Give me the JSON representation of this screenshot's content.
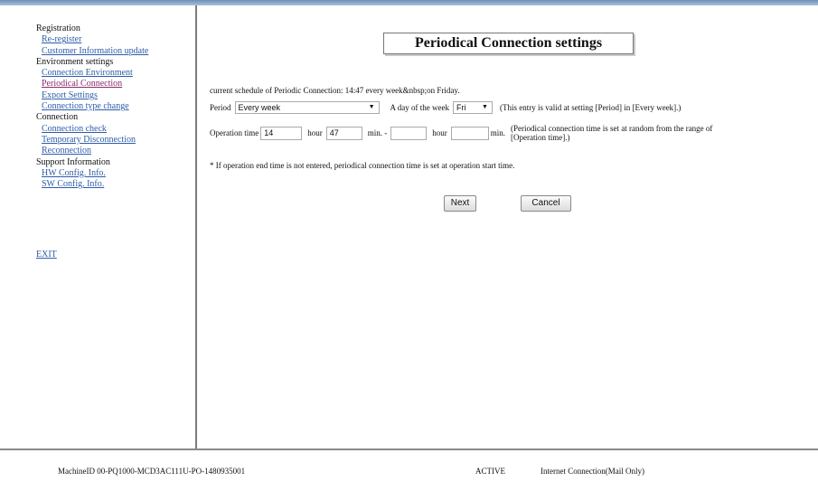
{
  "sidebar": {
    "sections": [
      {
        "title": "Registration",
        "links": [
          "Re-register",
          "Customer Information update"
        ]
      },
      {
        "title": "Environment settings",
        "links": [
          "Connection Environment",
          "Periodical Connection",
          "Export Settings",
          "Connection type change"
        ]
      },
      {
        "title": "Connection",
        "links": [
          "Connection check",
          "Temporary Disconnection",
          "Reconnection"
        ]
      },
      {
        "title": "Support Information",
        "links": [
          "HW Config. Info.",
          "SW Config. Info."
        ]
      }
    ],
    "exit": "EXIT"
  },
  "main": {
    "title": "Periodical Connection settings",
    "current_schedule": "current schedule of Periodic Connection: 14:47 every week&nbsp;on Friday.",
    "period_label": "Period",
    "period_value": "Every week",
    "day_label": "A day of the week",
    "day_value": "Fri",
    "day_note": "(This entry is valid at setting [Period] in [Every week].)",
    "op_label": "Operation time",
    "start_hour": "14",
    "hour_label": "hour",
    "start_min": "47",
    "min_dash_label": "min. -",
    "end_hour": "",
    "hour_label2": "hour",
    "end_min": "",
    "min_label2": "min.",
    "op_note_1": "(Periodical connection time is set at random from the range of",
    "op_note_2": "[Operation time].)",
    "note": "* If operation end time is not entered, periodical connection time is set at operation start time.",
    "next_label": "Next",
    "cancel_label": "Cancel"
  },
  "footer": {
    "machine_id": "MachineID  00-PQ1000-MCD3AC111U-PO-1480935001",
    "status": "ACTIVE",
    "connection": "Internet Connection(Mail Only)"
  }
}
